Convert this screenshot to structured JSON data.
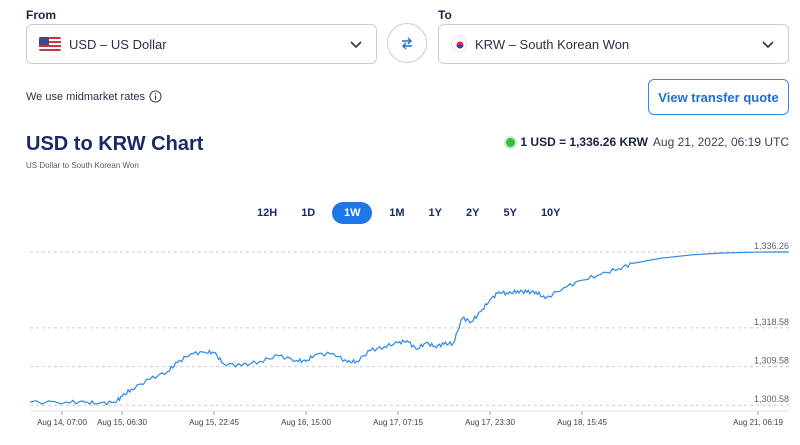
{
  "from": {
    "label": "From",
    "currency": "USD – US Dollar"
  },
  "to": {
    "label": "To",
    "currency": "KRW – South Korean Won"
  },
  "note": "We use midmarket rates",
  "transfer_button": "View transfer quote",
  "title": "USD to KRW Chart",
  "subtitle": "US Dollar to South Korean Won",
  "rate": {
    "pair": "1 USD = 1,336.26 KRW",
    "timestamp": "Aug 21, 2022, 06:19 UTC",
    "status_color": "#2fbf44"
  },
  "ranges": [
    "12H",
    "1D",
    "1W",
    "1M",
    "1Y",
    "2Y",
    "5Y",
    "10Y"
  ],
  "active_range": "1W",
  "colors": {
    "accent": "#1c78e8",
    "line": "#2b88e4",
    "title": "#1a2a66"
  },
  "chart_data": {
    "type": "line",
    "x_tick_labels": [
      "Aug 14, 07:00",
      "Aug 15, 06:30",
      "Aug 15, 22:45",
      "Aug 16, 15:00",
      "Aug 17, 07:15",
      "Aug 17, 23:30",
      "Aug 18, 15:45",
      "Aug 21, 06:19"
    ],
    "y_tick_labels": [
      "1,336.26",
      "1,318.58",
      "1,309.58",
      "1,300.58"
    ],
    "y_ticks": [
      1336.26,
      1318.58,
      1309.58,
      1300.58
    ],
    "ylim": [
      1299.7,
      1336.26
    ],
    "grid": true,
    "series": [
      {
        "x": [
          0,
          0.4,
          0.6,
          0.75,
          0.92,
          1.0,
          1.1,
          1.3,
          1.5,
          1.6,
          1.75,
          1.9,
          2.0,
          2.1,
          2.3,
          2.5,
          2.7,
          2.9,
          3.0,
          3.1,
          3.3,
          3.45,
          3.55,
          3.7,
          3.85,
          4.0,
          4.1,
          4.2,
          4.3,
          4.4,
          4.5,
          4.6,
          4.7,
          4.8,
          4.9,
          5.0,
          5.1,
          5.2,
          5.3,
          5.4,
          5.5,
          5.6,
          5.8,
          6.0,
          6.2,
          6.4,
          6.55,
          6.85,
          7.2,
          7.5,
          7.8,
          8.0,
          8.25
        ],
        "values": [
          1301.3,
          1301.3,
          1301.3,
          1301.0,
          1301.3,
          1302.6,
          1304.3,
          1306.6,
          1308.5,
          1310.5,
          1312.6,
          1312.9,
          1312.9,
          1310.3,
          1309.8,
          1310.8,
          1312.1,
          1311.0,
          1310.8,
          1312.4,
          1312.6,
          1310.6,
          1310.8,
          1313.3,
          1314.2,
          1315.1,
          1315.6,
          1313.6,
          1315.1,
          1314.3,
          1314.8,
          1315.0,
          1320.9,
          1320.0,
          1322.4,
          1325.1,
          1327.0,
          1326.5,
          1327.2,
          1326.9,
          1327.0,
          1325.4,
          1327.9,
          1329.7,
          1331.0,
          1332.4,
          1333.6,
          1334.8,
          1335.6,
          1336.0,
          1336.2,
          1336.26,
          1336.26
        ]
      }
    ]
  }
}
